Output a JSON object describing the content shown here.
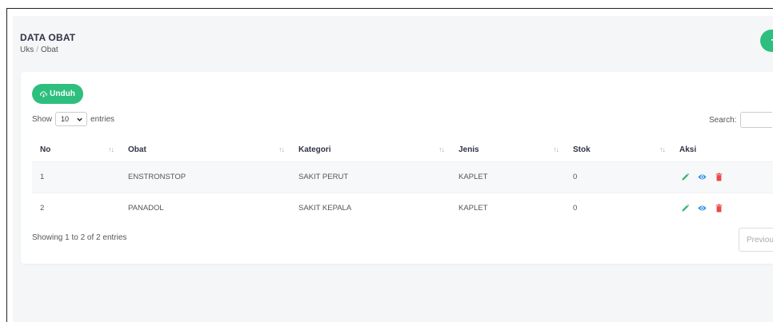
{
  "header": {
    "title": "DATA OBAT",
    "breadcrumb": [
      "Uks",
      "Obat"
    ],
    "add_label": "+"
  },
  "toolbar": {
    "download_label": "Unduh",
    "show_label": "Show",
    "entries_value": "10",
    "entries_label": "entries",
    "search_label": "Search:"
  },
  "table": {
    "columns": [
      "No",
      "Obat",
      "Kategori",
      "Jenis",
      "Stok",
      "Aksi"
    ],
    "rows": [
      {
        "no": "1",
        "obat": "ENSTRONSTOP",
        "kategori": "SAKIT PERUT",
        "jenis": "KAPLET",
        "stok": "0"
      },
      {
        "no": "2",
        "obat": "PANADOL",
        "kategori": "SAKIT KEPALA",
        "jenis": "KAPLET",
        "stok": "0"
      }
    ],
    "action_icons": [
      "edit-icon",
      "view-icon",
      "delete-icon"
    ]
  },
  "footer": {
    "showing_text": "Showing 1 to 2 of 2 entries",
    "previous_label": "Previou"
  },
  "colors": {
    "accent": "#2ebf7f",
    "edit": "#2eb36d",
    "view": "#2d8fe6",
    "delete": "#e84a4a"
  }
}
